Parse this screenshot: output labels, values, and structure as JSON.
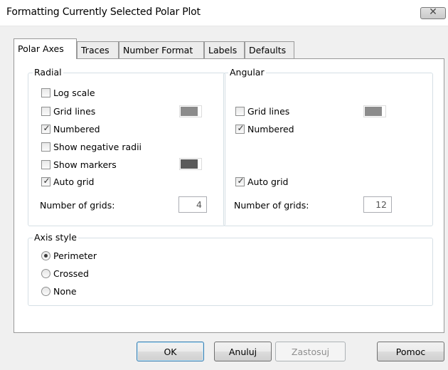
{
  "window": {
    "title": "Formatting Currently Selected Polar Plot",
    "close_glyph": "✕",
    "close_icon": "close-icon"
  },
  "tabs": [
    {
      "label": "Polar Axes",
      "active": true
    },
    {
      "label": "Traces",
      "active": false
    },
    {
      "label": "Number Format",
      "active": false
    },
    {
      "label": "Labels",
      "active": false
    },
    {
      "label": "Defaults",
      "active": false
    }
  ],
  "radial": {
    "title": "Radial",
    "log_scale": {
      "label": "Log scale",
      "checked": false
    },
    "grid_lines": {
      "label": "Grid lines",
      "checked": false,
      "color": "#8c8c8c"
    },
    "numbered": {
      "label": "Numbered",
      "checked": true
    },
    "show_negative_radii": {
      "label": "Show negative radii",
      "checked": false
    },
    "show_markers": {
      "label": "Show markers",
      "checked": false,
      "color": "#5a5a5a"
    },
    "auto_grid": {
      "label": "Auto grid",
      "checked": true
    },
    "number_of_grids": {
      "label": "Number of grids:",
      "value": "4"
    }
  },
  "angular": {
    "title": "Angular",
    "grid_lines": {
      "label": "Grid lines",
      "checked": false,
      "color": "#8c8c8c"
    },
    "numbered": {
      "label": "Numbered",
      "checked": true
    },
    "auto_grid": {
      "label": "Auto grid",
      "checked": true
    },
    "number_of_grids": {
      "label": "Number of grids:",
      "value": "12"
    }
  },
  "axis_style": {
    "title": "Axis style",
    "options": [
      {
        "label": "Perimeter",
        "selected": true
      },
      {
        "label": "Crossed",
        "selected": false
      },
      {
        "label": "None",
        "selected": false
      }
    ]
  },
  "buttons": {
    "ok": "OK",
    "cancel": "Anuluj",
    "apply": "Zastosuj",
    "help": "Pomoc"
  },
  "check_glyph": "✓"
}
